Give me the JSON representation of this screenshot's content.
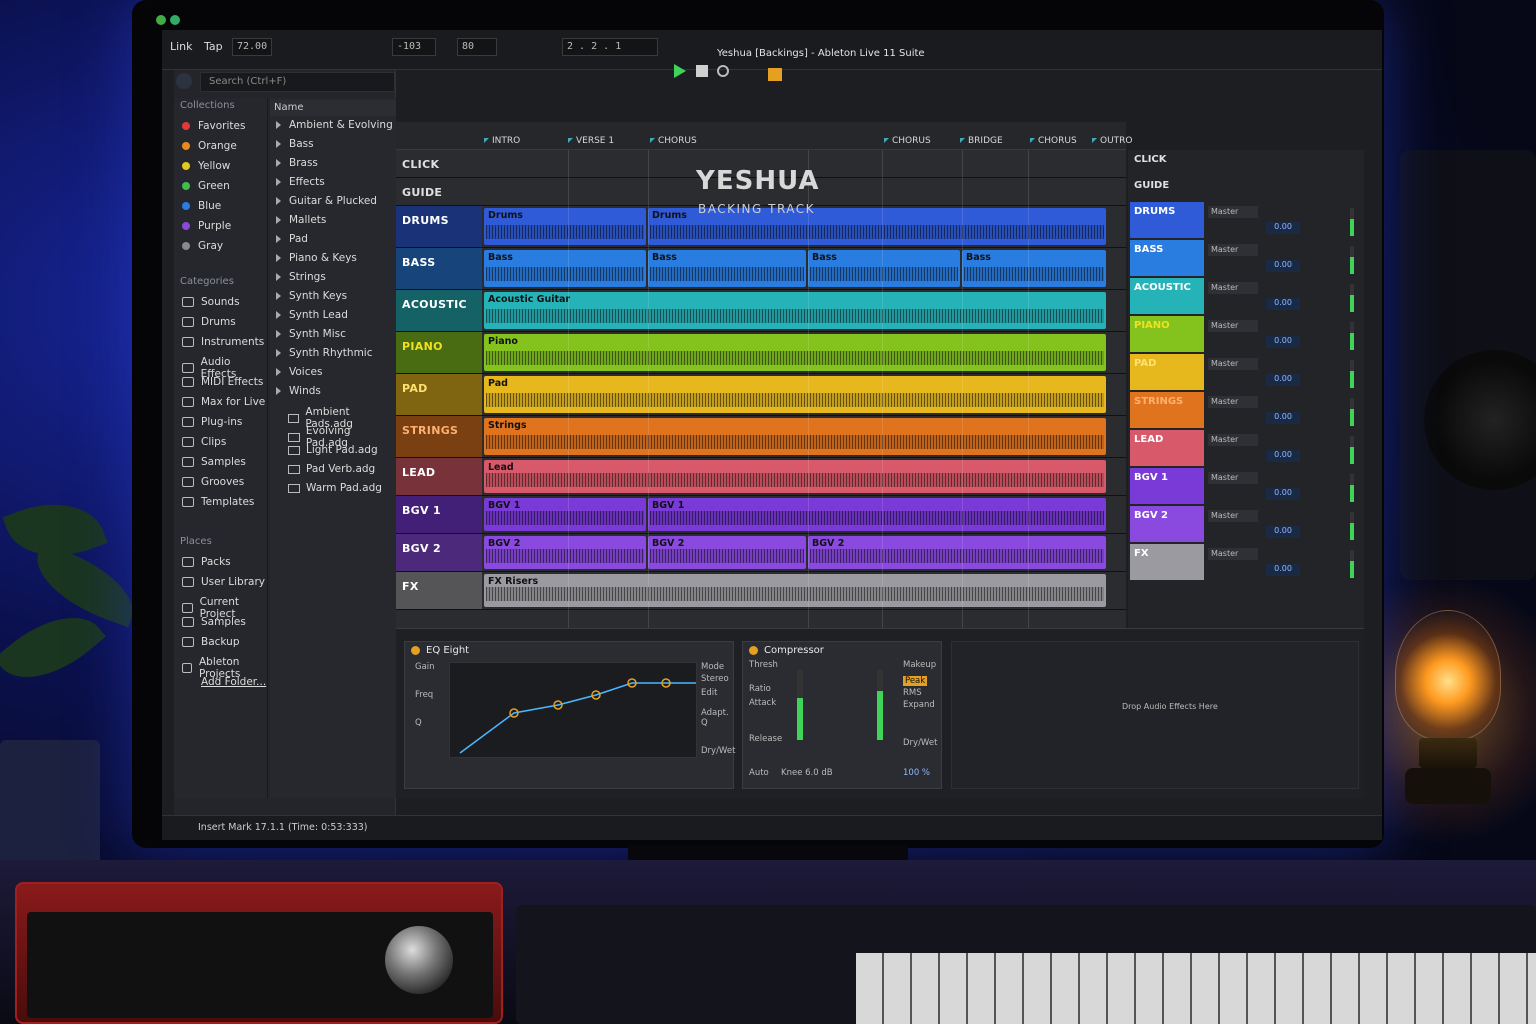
{
  "window": {
    "title": "Yeshua [Backings] - Ableton Live 11 Suite"
  },
  "transport": {
    "link": "Link",
    "tap": "Tap",
    "tempo": "72.00",
    "bar": "2",
    "beat": "2",
    "sixteenth": "1",
    "cpu_display": "-103",
    "pos2": "80"
  },
  "browser": {
    "search_placeholder": "Search (Ctrl+F)",
    "collections_header": "Collections",
    "collections": [
      {
        "label": "Favorites",
        "color": "#e03a3a"
      },
      {
        "label": "Orange",
        "color": "#e88a1e"
      },
      {
        "label": "Yellow",
        "color": "#e6c71e"
      },
      {
        "label": "Green",
        "color": "#3fbf4a"
      },
      {
        "label": "Blue",
        "color": "#2a7de0"
      },
      {
        "label": "Purple",
        "color": "#8a4ad8"
      },
      {
        "label": "Gray",
        "color": "#8a8a8a"
      }
    ],
    "categories_header": "Categories",
    "categories": [
      "Sounds",
      "Drums",
      "Instruments",
      "Audio Effects",
      "MIDI Effects",
      "Max for Live",
      "Plug-ins",
      "Clips",
      "Samples",
      "Grooves",
      "Templates"
    ],
    "places_header": "Places",
    "places": [
      "Packs",
      "User Library",
      "Current Project",
      "Samples",
      "Backup",
      "Ableton Projects"
    ],
    "add_folder": "Add Folder...",
    "name_header": "Name",
    "name_items": [
      "Ambient & Evolving",
      "Bass",
      "Brass",
      "Effects",
      "Guitar & Plucked",
      "Mallets",
      "Pad",
      "Piano & Keys",
      "Strings",
      "Synth Keys",
      "Synth Lead",
      "Synth Misc",
      "Synth Rhythmic",
      "Voices",
      "Winds"
    ],
    "files": [
      "Ambient Pads.adg",
      "Evolving Pad.adg",
      "Light Pad.adg",
      "Pad Verb.adg",
      "Warm Pad.adg"
    ]
  },
  "arrangement": {
    "banner_title": "YESHUA",
    "banner_subtitle": "BACKING TRACK",
    "markers": [
      "INTRO",
      "VERSE 1",
      "CHORUS",
      "CHORUS",
      "BRIDGE",
      "CHORUS",
      "OUTRO"
    ],
    "tracks": [
      {
        "name": "CLICK",
        "color": "#2a2c30",
        "text": "#e0e0e0",
        "clips": []
      },
      {
        "name": "GUIDE",
        "color": "#2a2c30",
        "text": "#e0e0e0",
        "clips": []
      },
      {
        "name": "DRUMS",
        "color": "#2f5bd8",
        "text": "#ffffff",
        "clips": [
          "Drums",
          "Drums"
        ]
      },
      {
        "name": "BASS",
        "color": "#2a7de0",
        "text": "#ffffff",
        "clips": [
          "Bass",
          "Bass",
          "Bass",
          "Bass"
        ]
      },
      {
        "name": "ACOUSTIC",
        "color": "#25b3b8",
        "text": "#ffffff",
        "clips": [
          "Acoustic Guitar"
        ]
      },
      {
        "name": "PIANO",
        "color": "#84c31e",
        "text": "#f0e020",
        "clips": [
          "Piano"
        ]
      },
      {
        "name": "PAD",
        "color": "#e6b81e",
        "text": "#ffe070",
        "clips": [
          "Pad"
        ]
      },
      {
        "name": "STRINGS",
        "color": "#e0741e",
        "text": "#ffb070",
        "clips": [
          "Strings"
        ]
      },
      {
        "name": "LEAD",
        "color": "#d85a6a",
        "text": "#ffffff",
        "clips": [
          "Lead"
        ]
      },
      {
        "name": "BGV 1",
        "color": "#7a3ad8",
        "text": "#ffffff",
        "clips": [
          "BGV 1",
          "BGV 1"
        ]
      },
      {
        "name": "BGV 2",
        "color": "#8a4ae0",
        "text": "#ffffff",
        "clips": [
          "BGV 2",
          "BGV 2",
          "BGV 2"
        ]
      },
      {
        "name": "FX",
        "color": "#9a9aa0",
        "text": "#ffffff",
        "clips": [
          "FX Risers"
        ]
      }
    ]
  },
  "mixer": {
    "output": "Master",
    "volume": "0.00",
    "channels": [
      "CLICK",
      "GUIDE",
      "DRUMS",
      "BASS",
      "ACOUSTIC",
      "PIANO",
      "PAD",
      "STRINGS",
      "LEAD",
      "BGV 1",
      "BGV 2",
      "FX"
    ]
  },
  "devices": {
    "eq_name": "EQ Eight",
    "eq_labels": [
      "Gain",
      "Freq",
      "Q"
    ],
    "eq_mode_label": "Mode",
    "eq_mode_value": "Stereo",
    "eq_edit": "Edit",
    "eq_adapt": "Adapt. Q",
    "eq_drywet": "Dry/Wet",
    "comp_name": "Compressor",
    "comp_labels": [
      "Thresh",
      "Ratio",
      "Attack",
      "Release",
      "Auto"
    ],
    "comp_mode": [
      "Peak",
      "RMS",
      "Expand"
    ],
    "comp_knee": "Knee 6.0 dB",
    "comp_drywet": "Dry/Wet",
    "comp_drywet_value": "100 %",
    "comp_makeup": "Makeup",
    "drop_text": "Drop Audio Effects Here"
  },
  "status": {
    "text": "Insert Mark 17.1.1 (Time: 0:53:333)"
  }
}
